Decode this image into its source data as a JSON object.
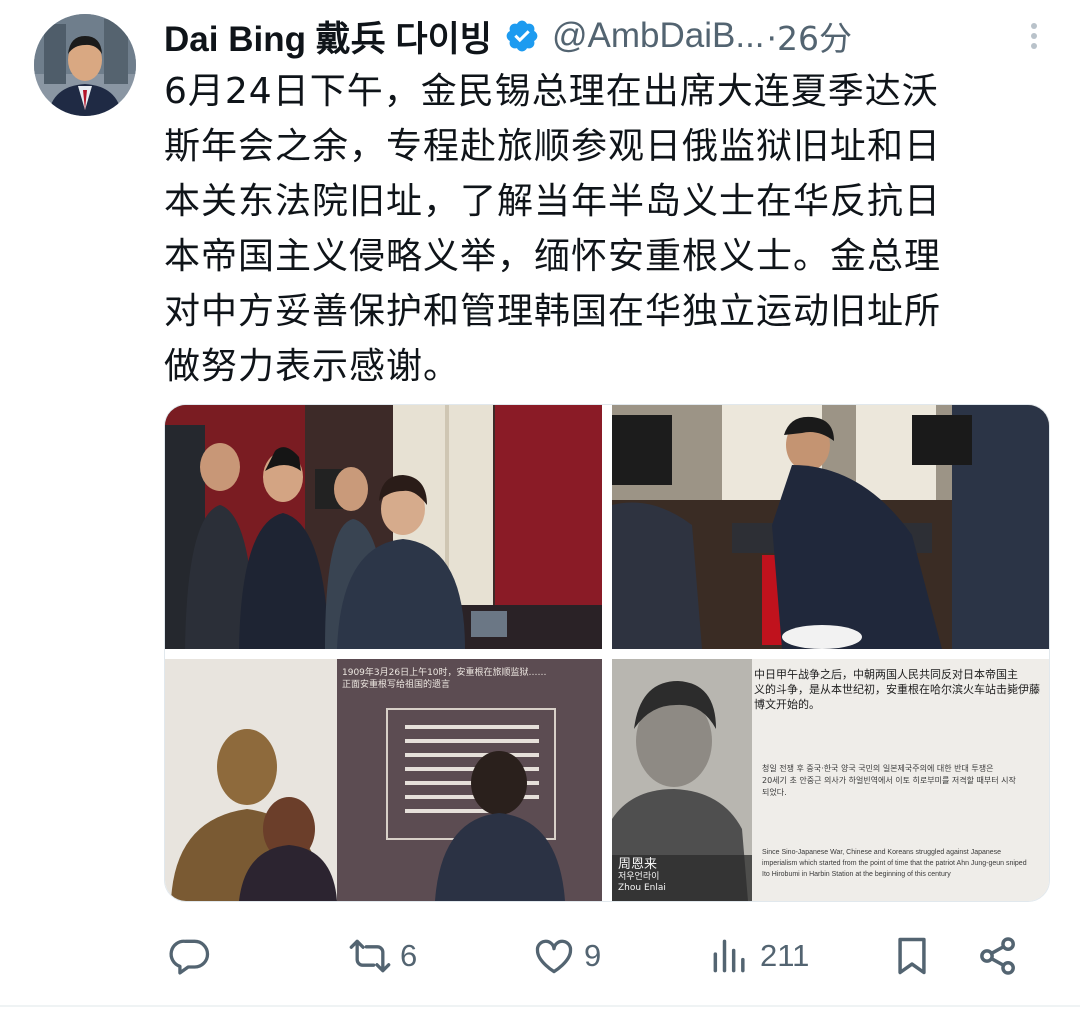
{
  "author": {
    "name": "Dai Bing 戴兵 다이빙",
    "handle": "@AmbDaiB...",
    "time": "·26分"
  },
  "tweet": {
    "lines": [
      "6月24日下午，金民锡总理在出席大连夏季达沃",
      "斯年会之余，专程赴旅顺参观日俄监狱旧址和日",
      "本关东法院旧址，了解当年半岛义士在华反抗日",
      "本帝国主义侵略义举，缅怀安重根义士。金总理",
      "对中方妥善保护和管理韩国在华独立运动旧址所",
      "做努力表示感谢。"
    ]
  },
  "media": {
    "photo3_sign_lines": [
      "1909年3月26日上午10时，安重根在旅顺监狱……",
      "正面安重根写给祖国的遗言"
    ],
    "photo4": {
      "zh_lines": [
        "中日甲午战争之后，中朝两国人民共同反对日本帝国主",
        "义的斗争，是从本世纪初，安重根在哈尔滨火车站击毙伊藤",
        "博文开始的。"
      ],
      "ko_lines": [
        "청일 전쟁 후 중국·한국 양국 국민의 일본제국주의에 대한 반대 투쟁은",
        "20세기 초 안중근 의사가 하얼빈역에서 이토 히로부미를 저격할 때부터 시작",
        "되었다."
      ],
      "en_lines": [
        "Since Sino-Japanese War, Chinese and Koreans struggled against Japanese",
        "imperialism which started from the point of time that the patriot Ahn Jung-geun sniped",
        "Ito Hirobumi in Harbin Station at the beginning of this century"
      ],
      "caption_zh": "周恩来",
      "caption_ko": "저우언라이",
      "caption_en": "Zhou Enlai"
    }
  },
  "actions": {
    "reply_count": "",
    "retweet_count": "6",
    "like_count": "9",
    "views_count": "211"
  },
  "colors": {
    "verified": "#1d9bf0",
    "text": "#0f1419",
    "muted": "#536471"
  }
}
